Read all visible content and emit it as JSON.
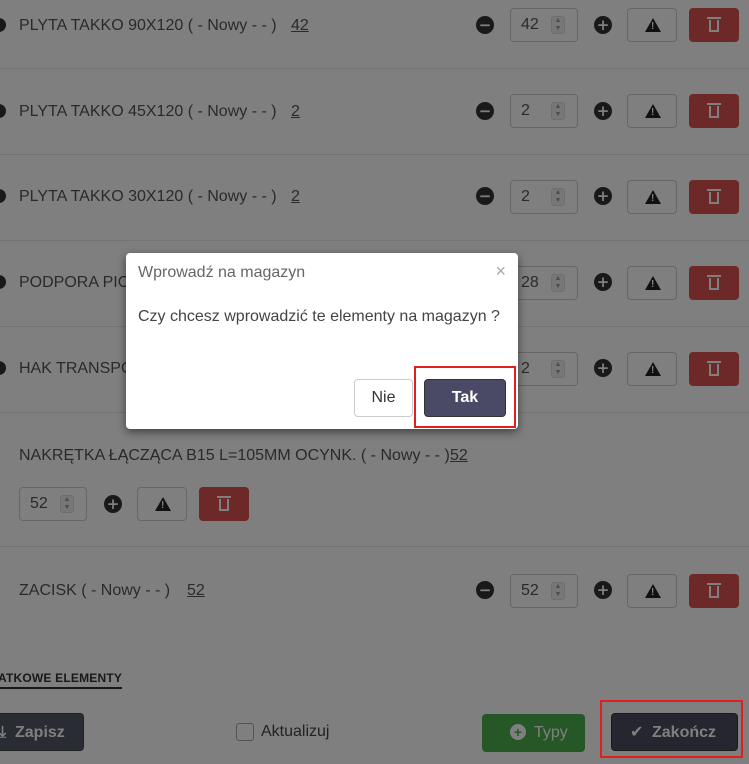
{
  "items": [
    {
      "name": "PLYTA TAKKO 90X120 ( - Nowy - - )",
      "qty": "42",
      "stepper_value": "42"
    },
    {
      "name": "PLYTA TAKKO 45X120 ( - Nowy - - )",
      "qty": "2",
      "stepper_value": "2"
    },
    {
      "name": "PLYTA TAKKO 30X120 ( - Nowy - - )",
      "qty": "2",
      "stepper_value": "2"
    },
    {
      "name": "PODPORA PIO",
      "qty": "",
      "stepper_value": "28"
    },
    {
      "name": "HAK TRANSPO",
      "qty": "",
      "stepper_value": "2"
    },
    {
      "name": "NAKRĘTKA ŁĄCZĄCA B15 L=105MM OCYNK. ( - Nowy - - )",
      "qty": "52",
      "stepper_value": "52"
    },
    {
      "name": "ZACISK ( - Nowy - - )",
      "qty": "52",
      "stepper_value": "52"
    }
  ],
  "section": {
    "label": "ATKOWE ELEMENTY"
  },
  "footer": {
    "save_label": "Zapisz",
    "update_label": "Aktualizuj",
    "types_label": "Typy",
    "finish_label": "Zakończ"
  },
  "modal": {
    "title": "Wprowadź na magazyn",
    "close": "×",
    "body": "Czy chcesz wprowadzić te elementy na magazyn ?",
    "no_label": "Nie",
    "yes_label": "Tak"
  },
  "colors": {
    "danger": "#d9534f",
    "success": "#4cae4c",
    "primary_dark": "#4a4a66",
    "highlight": "#e02020"
  },
  "icons": {
    "minus": "minus-circle-icon",
    "plus": "plus-circle-icon",
    "warning": "warning-icon",
    "trash": "trash-icon",
    "check": "check-icon",
    "download": "download-icon"
  }
}
